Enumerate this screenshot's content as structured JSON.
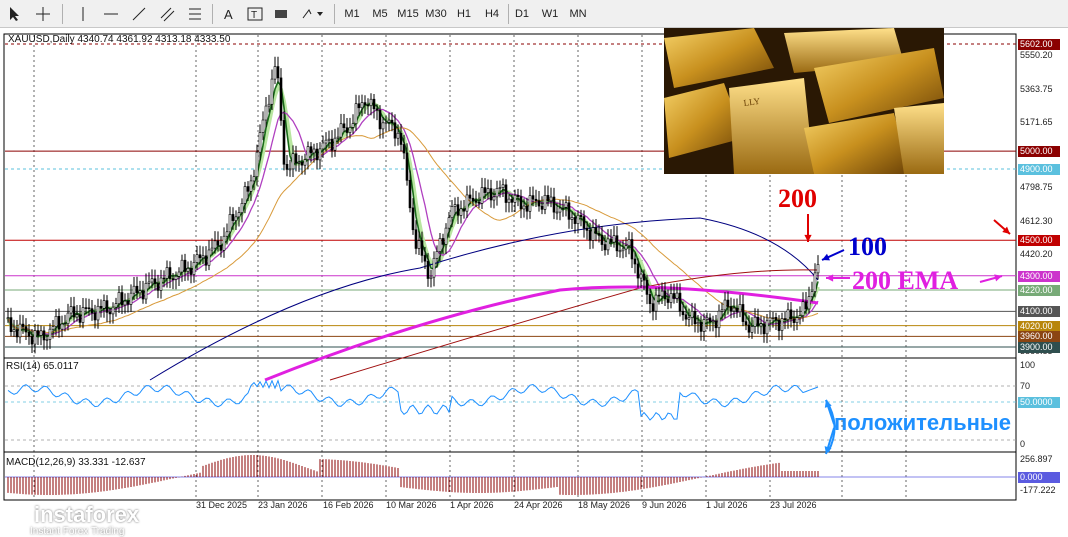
{
  "toolbar": {
    "timeframes": [
      "M1",
      "M5",
      "M15",
      "M30",
      "H1",
      "H4",
      "D1",
      "W1",
      "MN"
    ]
  },
  "chart": {
    "header": "XAUUSD,Daily  4340.74 4361.92 4313.18 4333.50",
    "rsi_label": "RSI(14) 65.0117",
    "macd_label": "MACD(12,26,9) 33.331 -12.637"
  },
  "price_axis": {
    "labels": [
      "5550.20",
      "5363.75",
      "5171.65",
      "4798.75",
      "4612.30",
      "4420.20",
      "3860.85"
    ],
    "tags": [
      {
        "text": "5602.00",
        "color": "#8b0000"
      },
      {
        "text": "5000.00",
        "color": "#8b0000"
      },
      {
        "text": "4900.00",
        "color": "#5bc0de"
      },
      {
        "text": "4500.00",
        "color": "#c00000"
      },
      {
        "text": "4300.00",
        "color": "#cc33cc"
      },
      {
        "text": "4220.00",
        "color": "#77aa77"
      },
      {
        "text": "4100.00",
        "color": "#555555"
      },
      {
        "text": "4020.00",
        "color": "#b8860b"
      },
      {
        "text": "3960.00",
        "color": "#8b4513"
      },
      {
        "text": "3900.00",
        "color": "#2f4f4f"
      }
    ]
  },
  "rsi_axis": {
    "labels": [
      "100",
      "70",
      "0"
    ],
    "tag": "50.0000"
  },
  "macd_axis": {
    "labels": [
      "256.897",
      "-177.222"
    ],
    "tag": "0.000"
  },
  "dates": [
    "31 Dec 2025",
    "23 Jan 2026",
    "16 Feb 2026",
    "10 Mar 2026",
    "1 Apr 2026",
    "24 Apr 2026",
    "18 May 2026",
    "9 Jun 2026",
    "1 Jul 2026",
    "23 Jul 2026"
  ],
  "annotations": {
    "ma200": "200",
    "ma100": "100",
    "ema200": "200 EMA",
    "positive": "положительные"
  },
  "logo": {
    "brand": "instaforex",
    "tagline": "Instant Forex Trading"
  },
  "colors": {
    "red": "#e00000",
    "blue": "#0000cc",
    "magenta": "#e020e0",
    "cyan": "#1e90ff"
  }
}
